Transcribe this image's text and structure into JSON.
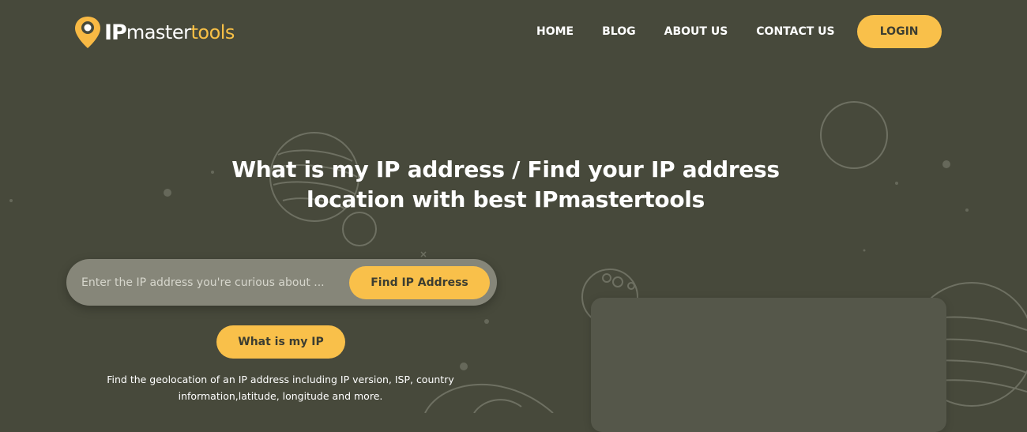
{
  "brand": {
    "logo_ip": "IP",
    "logo_master": "master",
    "logo_tools": "tools",
    "accent_color": "#f9c04a",
    "background_color": "#47493b"
  },
  "nav": {
    "items": [
      {
        "label": "HOME"
      },
      {
        "label": "BLOG"
      },
      {
        "label": "ABOUT US"
      },
      {
        "label": "CONTACT US"
      }
    ],
    "login_label": "LOGIN"
  },
  "hero": {
    "title_line1": "What is my IP address / Find your IP address",
    "title_line2": "location with best IPmastertools"
  },
  "search": {
    "placeholder": "Enter the IP address you're curious about ...",
    "value": "",
    "button_label": "Find IP Address"
  },
  "my_ip": {
    "button_label": "What is my IP"
  },
  "description": {
    "line1": "Find the geolocation of an IP address including IP version, ISP, country",
    "line2": "information,latitude, longitude and more."
  },
  "icons": {
    "logo_icon": "location-pin-icon"
  }
}
